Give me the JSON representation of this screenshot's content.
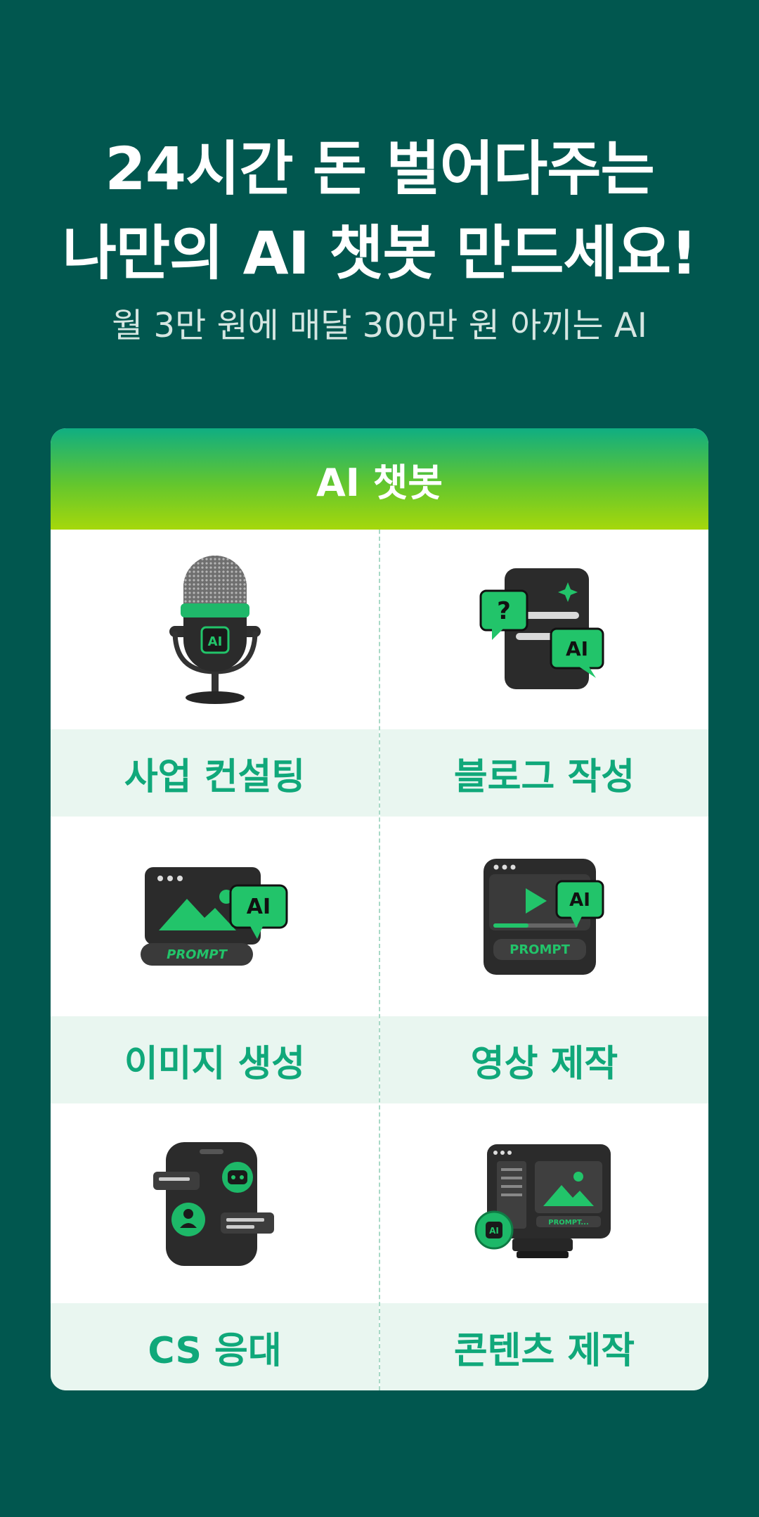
{
  "headline": {
    "line1": "24시간 돈 벌어다주는",
    "line2": "나만의 AI 챗봇 만드세요!"
  },
  "subheadline": "월 3만 원에 매달 300만 원 아끼는 AI",
  "card": {
    "header": "AI 챗봇",
    "items": [
      {
        "label": "사업 컨설팅",
        "icon": "ai-microphone-icon",
        "icon_text": "AI"
      },
      {
        "label": "블로그 작성",
        "icon": "ai-blog-document-icon",
        "icon_text": "AI",
        "icon_text2": "?"
      },
      {
        "label": "이미지 생성",
        "icon": "ai-image-prompt-icon",
        "icon_text": "AI",
        "icon_text2": "PROMPT"
      },
      {
        "label": "영상 제작",
        "icon": "ai-video-prompt-icon",
        "icon_text": "AI",
        "icon_text2": "PROMPT"
      },
      {
        "label": "CS 응대",
        "icon": "chat-robot-phone-icon"
      },
      {
        "label": "콘텐츠 제작",
        "icon": "ai-content-monitor-icon",
        "icon_text": "AI",
        "icon_text2": "PROMPT..."
      }
    ]
  },
  "colors": {
    "background": "#01574f",
    "accent_green": "#10a87a",
    "label_bg": "#e9f6f0",
    "icon_green": "#22c46a",
    "icon_dark": "#2b2b2b"
  }
}
